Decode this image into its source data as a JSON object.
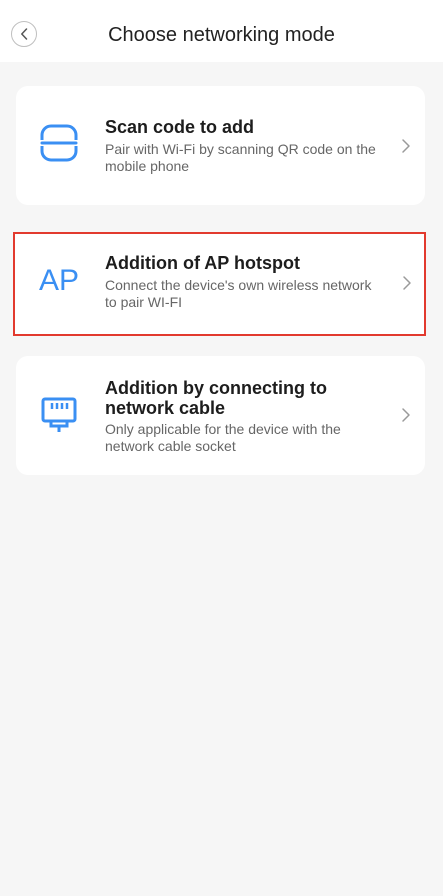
{
  "header": {
    "title": "Choose networking mode"
  },
  "options": [
    {
      "title": "Scan code to add",
      "description": "Pair with Wi-Fi by scanning QR code on the mobile phone",
      "icon": "scan-icon"
    },
    {
      "title": "Addition of AP hotspot",
      "description": "Connect the device's own wireless network to pair WI-FI",
      "icon_text": "AP",
      "icon": "ap-icon",
      "highlighted": true
    },
    {
      "title": "Addition by connecting to network cable",
      "description": "Only applicable for the device with the network cable socket",
      "icon": "ethernet-icon"
    }
  ],
  "colors": {
    "accent": "#3a8ff3",
    "highlight_border": "#e23a2e",
    "background": "#f6f6f6"
  }
}
